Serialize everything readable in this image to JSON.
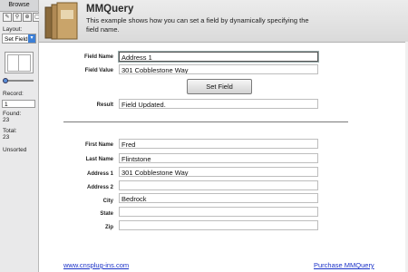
{
  "status": {
    "mode_tab": "Browse",
    "layout_label": "Layout:",
    "layout_value": "Set Field",
    "record_label": "Record:",
    "record_value": "1",
    "found_label": "Found:",
    "found_value": "23",
    "total_label": "Total:",
    "total_value": "23",
    "sort_status": "Unsorted"
  },
  "header": {
    "title": "MMQuery",
    "description": "This example shows how you can set a field by dynamically specifying the field name."
  },
  "set_field": {
    "field_name_label": "Field Name",
    "field_name_value": "Address 1",
    "field_value_label": "Field Value",
    "field_value_value": "301 Cobblestone Way",
    "button_label": "Set Field",
    "result_label": "Result",
    "result_value": "Field Updated."
  },
  "record": {
    "first_name_label": "First Name",
    "first_name": "Fred",
    "last_name_label": "Last Name",
    "last_name": "Flintstone",
    "address1_label": "Address 1",
    "address1": "301 Cobblestone Way",
    "address2_label": "Address 2",
    "address2": "",
    "city_label": "City",
    "city": "Bedrock",
    "state_label": "State",
    "state": "",
    "zip_label": "Zip",
    "zip": ""
  },
  "footer": {
    "left_link": "www.cnsplug-ins.com",
    "right_link": "Purchase MMQuery"
  },
  "colors": {
    "link": "#1b32c8",
    "accent": "#3c7fd6"
  }
}
